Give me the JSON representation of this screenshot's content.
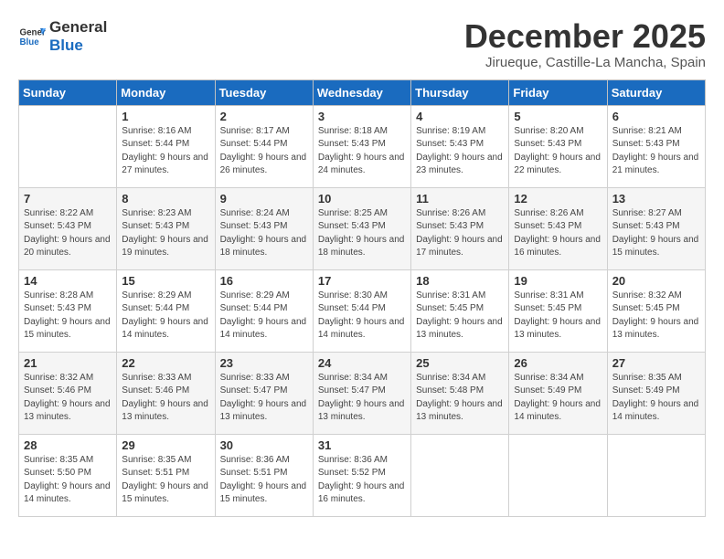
{
  "logo": {
    "text_general": "General",
    "text_blue": "Blue"
  },
  "title": {
    "month": "December 2025",
    "location": "Jirueque, Castille-La Mancha, Spain"
  },
  "weekdays": [
    "Sunday",
    "Monday",
    "Tuesday",
    "Wednesday",
    "Thursday",
    "Friday",
    "Saturday"
  ],
  "weeks": [
    [
      {
        "day": "",
        "sunrise": "",
        "sunset": "",
        "daylight": ""
      },
      {
        "day": "1",
        "sunrise": "Sunrise: 8:16 AM",
        "sunset": "Sunset: 5:44 PM",
        "daylight": "Daylight: 9 hours and 27 minutes."
      },
      {
        "day": "2",
        "sunrise": "Sunrise: 8:17 AM",
        "sunset": "Sunset: 5:44 PM",
        "daylight": "Daylight: 9 hours and 26 minutes."
      },
      {
        "day": "3",
        "sunrise": "Sunrise: 8:18 AM",
        "sunset": "Sunset: 5:43 PM",
        "daylight": "Daylight: 9 hours and 24 minutes."
      },
      {
        "day": "4",
        "sunrise": "Sunrise: 8:19 AM",
        "sunset": "Sunset: 5:43 PM",
        "daylight": "Daylight: 9 hours and 23 minutes."
      },
      {
        "day": "5",
        "sunrise": "Sunrise: 8:20 AM",
        "sunset": "Sunset: 5:43 PM",
        "daylight": "Daylight: 9 hours and 22 minutes."
      },
      {
        "day": "6",
        "sunrise": "Sunrise: 8:21 AM",
        "sunset": "Sunset: 5:43 PM",
        "daylight": "Daylight: 9 hours and 21 minutes."
      }
    ],
    [
      {
        "day": "7",
        "sunrise": "Sunrise: 8:22 AM",
        "sunset": "Sunset: 5:43 PM",
        "daylight": "Daylight: 9 hours and 20 minutes."
      },
      {
        "day": "8",
        "sunrise": "Sunrise: 8:23 AM",
        "sunset": "Sunset: 5:43 PM",
        "daylight": "Daylight: 9 hours and 19 minutes."
      },
      {
        "day": "9",
        "sunrise": "Sunrise: 8:24 AM",
        "sunset": "Sunset: 5:43 PM",
        "daylight": "Daylight: 9 hours and 18 minutes."
      },
      {
        "day": "10",
        "sunrise": "Sunrise: 8:25 AM",
        "sunset": "Sunset: 5:43 PM",
        "daylight": "Daylight: 9 hours and 18 minutes."
      },
      {
        "day": "11",
        "sunrise": "Sunrise: 8:26 AM",
        "sunset": "Sunset: 5:43 PM",
        "daylight": "Daylight: 9 hours and 17 minutes."
      },
      {
        "day": "12",
        "sunrise": "Sunrise: 8:26 AM",
        "sunset": "Sunset: 5:43 PM",
        "daylight": "Daylight: 9 hours and 16 minutes."
      },
      {
        "day": "13",
        "sunrise": "Sunrise: 8:27 AM",
        "sunset": "Sunset: 5:43 PM",
        "daylight": "Daylight: 9 hours and 15 minutes."
      }
    ],
    [
      {
        "day": "14",
        "sunrise": "Sunrise: 8:28 AM",
        "sunset": "Sunset: 5:43 PM",
        "daylight": "Daylight: 9 hours and 15 minutes."
      },
      {
        "day": "15",
        "sunrise": "Sunrise: 8:29 AM",
        "sunset": "Sunset: 5:44 PM",
        "daylight": "Daylight: 9 hours and 14 minutes."
      },
      {
        "day": "16",
        "sunrise": "Sunrise: 8:29 AM",
        "sunset": "Sunset: 5:44 PM",
        "daylight": "Daylight: 9 hours and 14 minutes."
      },
      {
        "day": "17",
        "sunrise": "Sunrise: 8:30 AM",
        "sunset": "Sunset: 5:44 PM",
        "daylight": "Daylight: 9 hours and 14 minutes."
      },
      {
        "day": "18",
        "sunrise": "Sunrise: 8:31 AM",
        "sunset": "Sunset: 5:45 PM",
        "daylight": "Daylight: 9 hours and 13 minutes."
      },
      {
        "day": "19",
        "sunrise": "Sunrise: 8:31 AM",
        "sunset": "Sunset: 5:45 PM",
        "daylight": "Daylight: 9 hours and 13 minutes."
      },
      {
        "day": "20",
        "sunrise": "Sunrise: 8:32 AM",
        "sunset": "Sunset: 5:45 PM",
        "daylight": "Daylight: 9 hours and 13 minutes."
      }
    ],
    [
      {
        "day": "21",
        "sunrise": "Sunrise: 8:32 AM",
        "sunset": "Sunset: 5:46 PM",
        "daylight": "Daylight: 9 hours and 13 minutes."
      },
      {
        "day": "22",
        "sunrise": "Sunrise: 8:33 AM",
        "sunset": "Sunset: 5:46 PM",
        "daylight": "Daylight: 9 hours and 13 minutes."
      },
      {
        "day": "23",
        "sunrise": "Sunrise: 8:33 AM",
        "sunset": "Sunset: 5:47 PM",
        "daylight": "Daylight: 9 hours and 13 minutes."
      },
      {
        "day": "24",
        "sunrise": "Sunrise: 8:34 AM",
        "sunset": "Sunset: 5:47 PM",
        "daylight": "Daylight: 9 hours and 13 minutes."
      },
      {
        "day": "25",
        "sunrise": "Sunrise: 8:34 AM",
        "sunset": "Sunset: 5:48 PM",
        "daylight": "Daylight: 9 hours and 13 minutes."
      },
      {
        "day": "26",
        "sunrise": "Sunrise: 8:34 AM",
        "sunset": "Sunset: 5:49 PM",
        "daylight": "Daylight: 9 hours and 14 minutes."
      },
      {
        "day": "27",
        "sunrise": "Sunrise: 8:35 AM",
        "sunset": "Sunset: 5:49 PM",
        "daylight": "Daylight: 9 hours and 14 minutes."
      }
    ],
    [
      {
        "day": "28",
        "sunrise": "Sunrise: 8:35 AM",
        "sunset": "Sunset: 5:50 PM",
        "daylight": "Daylight: 9 hours and 14 minutes."
      },
      {
        "day": "29",
        "sunrise": "Sunrise: 8:35 AM",
        "sunset": "Sunset: 5:51 PM",
        "daylight": "Daylight: 9 hours and 15 minutes."
      },
      {
        "day": "30",
        "sunrise": "Sunrise: 8:36 AM",
        "sunset": "Sunset: 5:51 PM",
        "daylight": "Daylight: 9 hours and 15 minutes."
      },
      {
        "day": "31",
        "sunrise": "Sunrise: 8:36 AM",
        "sunset": "Sunset: 5:52 PM",
        "daylight": "Daylight: 9 hours and 16 minutes."
      },
      {
        "day": "",
        "sunrise": "",
        "sunset": "",
        "daylight": ""
      },
      {
        "day": "",
        "sunrise": "",
        "sunset": "",
        "daylight": ""
      },
      {
        "day": "",
        "sunrise": "",
        "sunset": "",
        "daylight": ""
      }
    ]
  ]
}
